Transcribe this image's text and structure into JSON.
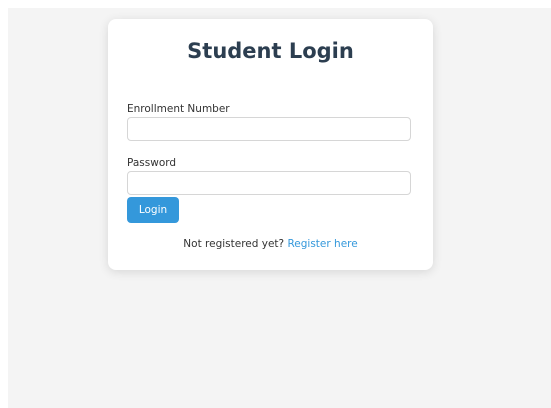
{
  "login": {
    "title": "Student Login",
    "enrollment_label": "Enrollment Number",
    "enrollment_value": "",
    "password_label": "Password",
    "password_value": "",
    "login_button": "Login",
    "register_prompt": "Not registered yet?",
    "register_link": "Register here"
  },
  "colors": {
    "background": "#f4f4f4",
    "card": "#ffffff",
    "title": "#2c3e50",
    "accent": "#3498db"
  }
}
